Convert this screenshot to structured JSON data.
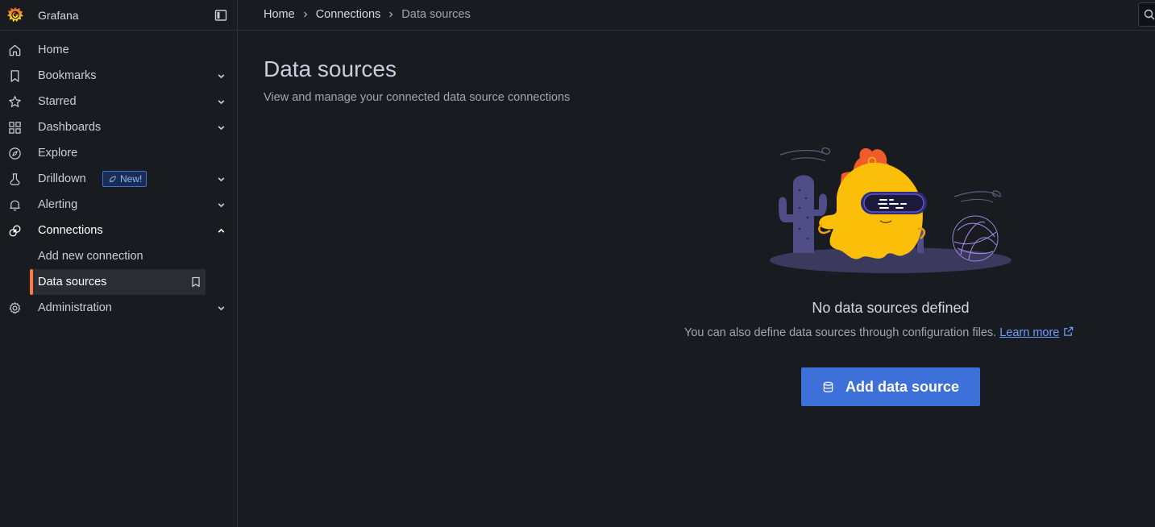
{
  "app": {
    "brand": "Grafana"
  },
  "breadcrumb": {
    "items": [
      "Home",
      "Connections",
      "Data sources"
    ]
  },
  "sidebar": {
    "items": [
      {
        "label": "Home",
        "icon": "home-icon",
        "chevron": ""
      },
      {
        "label": "Bookmarks",
        "icon": "bookmark-icon",
        "chevron": "down"
      },
      {
        "label": "Starred",
        "icon": "star-icon",
        "chevron": "down"
      },
      {
        "label": "Dashboards",
        "icon": "apps-icon",
        "chevron": "down"
      },
      {
        "label": "Explore",
        "icon": "compass-icon",
        "chevron": ""
      },
      {
        "label": "Drilldown",
        "icon": "drilldown-icon",
        "chevron": "down",
        "badge": "New!"
      },
      {
        "label": "Alerting",
        "icon": "bell-icon",
        "chevron": "down"
      },
      {
        "label": "Connections",
        "icon": "connections-icon",
        "chevron": "up"
      },
      {
        "label": "Administration",
        "icon": "cog-icon",
        "chevron": "down"
      }
    ],
    "connections_children": [
      {
        "label": "Add new connection"
      },
      {
        "label": "Data sources",
        "active": true
      }
    ]
  },
  "main": {
    "title": "Data sources",
    "subtitle": "View and manage your connected data source connections",
    "empty_state": {
      "title": "No data sources defined",
      "description": "You can also define data sources through configuration files.",
      "link_label": "Learn more",
      "button_label": "Add data source"
    }
  },
  "colors": {
    "accent_blue": "#3d71d9",
    "active_bar": "#ff7a3c",
    "link": "#6e9fff"
  }
}
